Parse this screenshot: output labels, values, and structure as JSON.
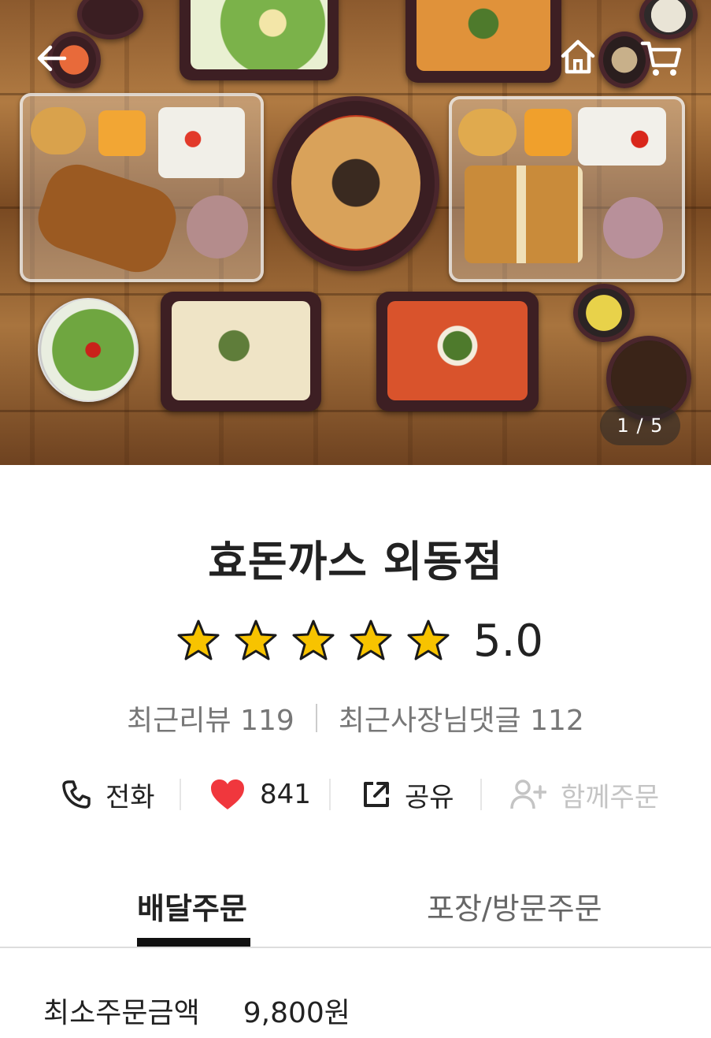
{
  "hero": {
    "pager": "1 / 5"
  },
  "store": {
    "name": "효돈까스 외동점",
    "rating": {
      "stars": 5,
      "max": 5,
      "score": "5.0"
    },
    "recent_reviews": "최근리뷰 119",
    "recent_owner_replies": "최근사장님댓글 112"
  },
  "actions": {
    "call": "전화",
    "like_count": "841",
    "share": "공유",
    "group_order": "함께주문"
  },
  "tabs": [
    {
      "label": "배달주문",
      "active": true
    },
    {
      "label": "포장/방문주문",
      "active": false
    }
  ],
  "order_info": {
    "min_order_label": "최소주문금액",
    "min_order_value": "9,800원"
  },
  "colors": {
    "star_fill": "#f7c300",
    "heart": "#f0373d",
    "tab_indicator": "#111111"
  },
  "icons": [
    "back-arrow-icon",
    "home-icon",
    "cart-icon",
    "phone-icon",
    "heart-icon",
    "share-icon",
    "group-order-icon",
    "star-icon"
  ]
}
